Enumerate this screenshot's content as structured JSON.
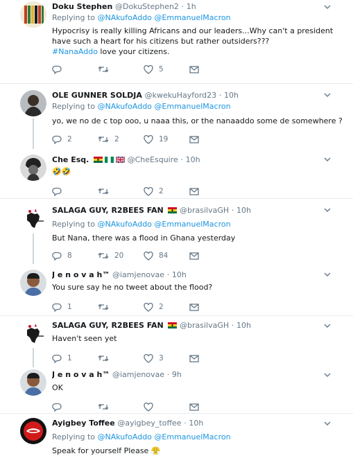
{
  "tweets": [
    {
      "name": "Doku Stephen",
      "handle": "@DokuStephen2",
      "dot": "·",
      "time": "1h",
      "reply_label": "Replying to",
      "reply_to": "@NAkufoAddo @EmmanuelMacron",
      "text": "Hypocrisy is really killing Africans and our leaders...Why can't a president have such a heart for his citizens but rather outsiders???",
      "hashtag": "#NanaAddo",
      "text_tail": " love your citizens.",
      "replies": "",
      "retweets": "",
      "likes": "5"
    },
    {
      "name": "OLE GUNNER SOLDJA",
      "handle": "@kwekuHayford23",
      "dot": "·",
      "time": "10h",
      "reply_label": "Replying to",
      "reply_to": "@NAkufoAddo @EmmanuelMacron",
      "text": "yo, we no de c top ooo, u naaa this, or the nanaaddo some de somewhere ?",
      "replies": "2",
      "retweets": "2",
      "likes": "19"
    },
    {
      "name": "Che Esq.",
      "handle": "@CheEsquire",
      "dot": "·",
      "time": "10h",
      "text": "🤣🤣",
      "replies": "",
      "retweets": "",
      "likes": "2"
    },
    {
      "name": "SALAGA GUY, R2BEES FAN",
      "handle": "@brasilvaGH",
      "dot": "·",
      "time": "10h",
      "reply_label": "Replying to",
      "reply_to": "@NAkufoAddo @EmmanuelMacron",
      "text": "But Nana, there was a flood in Ghana yesterday",
      "replies": "8",
      "retweets": "20",
      "likes": "84"
    },
    {
      "name": "J e n o v a h™",
      "handle": "@iamjenovae",
      "dot": "·",
      "time": "10h",
      "text": "You sure say he no tweet about the flood?",
      "replies": "1",
      "retweets": "",
      "likes": "2"
    },
    {
      "name": "SALAGA GUY, R2BEES FAN",
      "handle": "@brasilvaGH",
      "dot": "·",
      "time": "10h",
      "text": "Haven't seen yet",
      "replies": "1",
      "retweets": "",
      "likes": "3"
    },
    {
      "name": "J e n o v a h™",
      "handle": "@iamjenovae",
      "dot": "·",
      "time": "9h",
      "text": "OK",
      "replies": "",
      "retweets": "",
      "likes": ""
    },
    {
      "name": "Ayigbey Toffee",
      "handle": "@ayigbey_toffee",
      "dot": "·",
      "time": "10h",
      "reply_label": "Replying to",
      "reply_to": "@NAkufoAddo @EmmanuelMacron",
      "text": "Speak for yourself Please 😤",
      "replies": "",
      "retweets": "",
      "likes": ""
    }
  ],
  "icons": {
    "reply": "reply-icon",
    "retweet": "retweet-icon",
    "like": "heart-icon",
    "dm": "envelope-icon",
    "more": "chevron-down-icon"
  },
  "colors": {
    "link": "#1b95e0",
    "muted": "#657786",
    "text": "#14171a",
    "divider": "#e6ecf0",
    "thread": "#ccd6dd"
  }
}
